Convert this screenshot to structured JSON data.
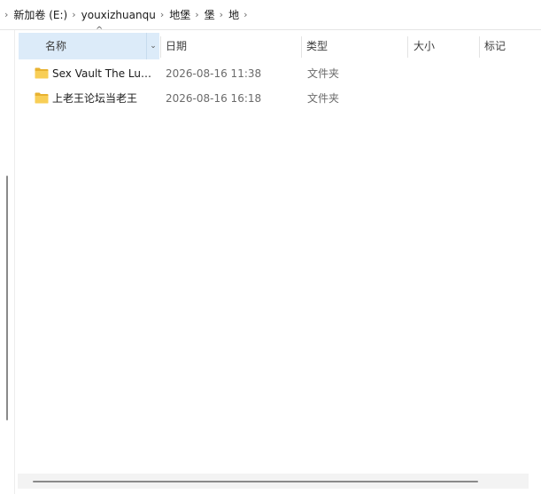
{
  "breadcrumb": {
    "items": [
      "新加卷 (E:)",
      "youxizhuanqu",
      "地堡",
      "堡",
      "地"
    ]
  },
  "columns": {
    "name": "名称",
    "date": "日期",
    "type": "类型",
    "size": "大小",
    "tag": "标记"
  },
  "files": [
    {
      "name": "Sex Vault The Lust…",
      "date": "2026-08-16 11:38",
      "type": "文件夹"
    },
    {
      "name": "上老王论坛当老王",
      "date": "2026-08-16 16:18",
      "type": "文件夹"
    }
  ],
  "icons": {
    "folder": "folder-icon",
    "chevron": "chevron-right-icon",
    "sort": "sort-ascending-icon",
    "dropdown": "chevron-down-icon"
  },
  "colors": {
    "folder": "#F5C542",
    "selected_header": "#DCEBF9"
  }
}
